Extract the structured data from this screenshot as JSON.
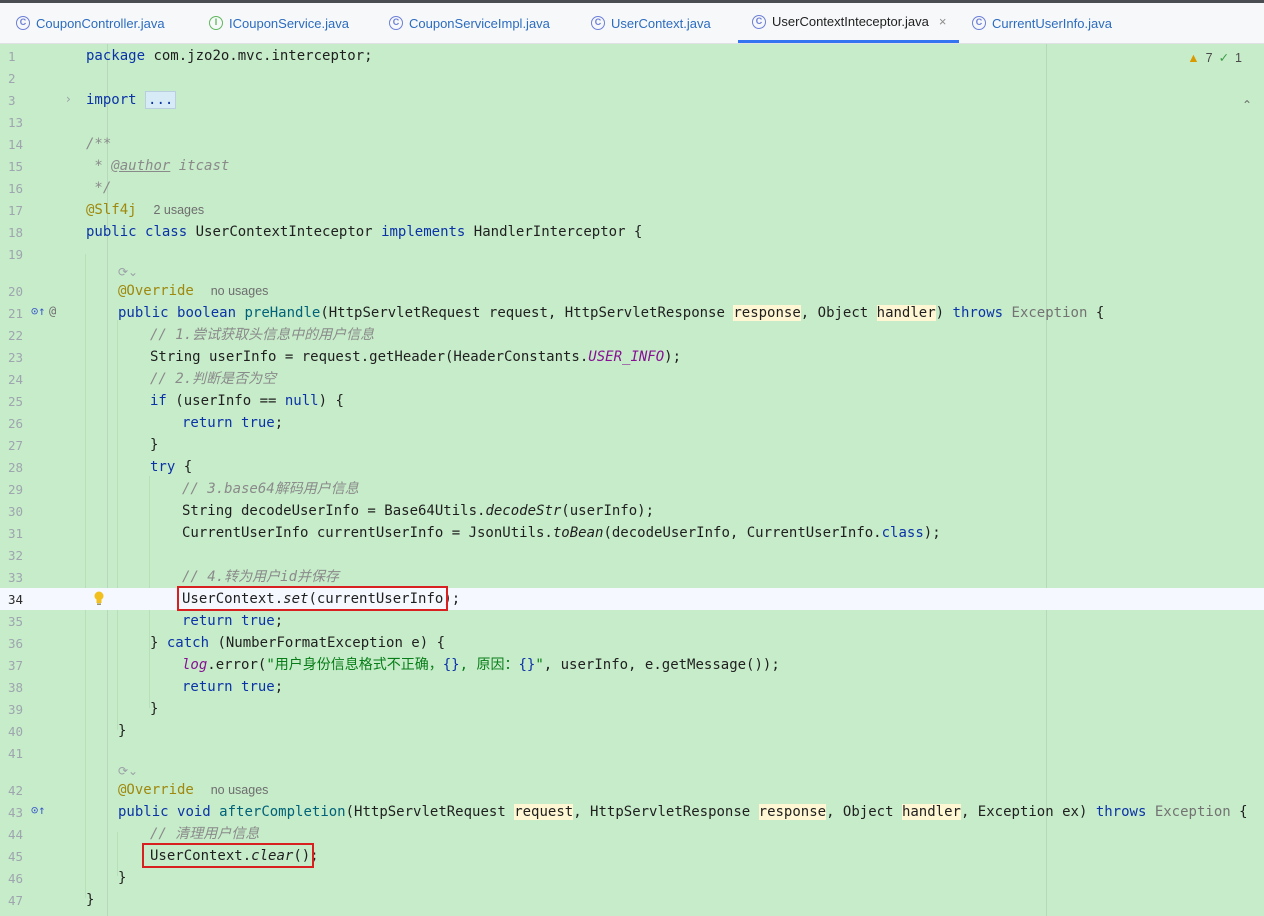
{
  "tabs": [
    {
      "label": "CouponController.java",
      "icon": "class-icon",
      "active": false
    },
    {
      "label": "ICouponService.java",
      "icon": "interface-icon",
      "active": false
    },
    {
      "label": "CouponServiceImpl.java",
      "icon": "class-icon",
      "active": false
    },
    {
      "label": "UserContext.java",
      "icon": "class-icon",
      "active": false
    },
    {
      "label": "UserContextInteceptor.java",
      "icon": "class-icon",
      "active": true
    },
    {
      "label": "CurrentUserInfo.java",
      "icon": "class-icon",
      "active": false
    }
  ],
  "inspections": {
    "warnings": "7",
    "weak_warnings": "1"
  },
  "current_line": "34",
  "code": {
    "l1_kw": "package",
    "l1_rest": " com.jzo2o.mvc.interceptor;",
    "l3_kw": "import",
    "l3_fold": "...",
    "l14": "/**",
    "l15_pre": " * ",
    "l15_tag": "@author",
    "l15_rest": " itcast",
    "l16": " */",
    "l17_ann": "@Slf4j",
    "l17_hint": "2 usages",
    "l18_kw1": "public",
    "l18_kw2": "class",
    "l18_name": "UserContextInteceptor",
    "l18_kw3": "implements",
    "l18_rest": " HandlerInterceptor {",
    "l20_ann": "@Override",
    "l20_hint": "no usages",
    "l21_kw1": "public",
    "l21_kw2": "boolean",
    "l21_method": "preHandle",
    "l21_a": "(HttpServletRequest request, HttpServletResponse ",
    "l21_p1": "response",
    "l21_b": ", Object ",
    "l21_p2": "handler",
    "l21_c": ") ",
    "l21_kw3": "throws",
    "l21_d": " Exception",
    "l21_e": " {",
    "l22": "// 1.尝试获取头信息中的用户信息",
    "l23_a": "String userInfo = request.getHeader(HeaderConstants.",
    "l23_const": "USER_INFO",
    "l23_b": ");",
    "l24": "// 2.判断是否为空",
    "l25_kw": "if",
    "l25_a": " (userInfo == ",
    "l25_kw2": "null",
    "l25_b": ") {",
    "l26_kw": "return",
    "l26_kw2": "true",
    "l26_b": ";",
    "l27": "}",
    "l28_kw": "try",
    "l28_b": " {",
    "l29": "// 3.base64解码用户信息",
    "l30_a": "String decodeUserInfo = Base64Utils.",
    "l30_m": "decodeStr",
    "l30_b": "(userInfo);",
    "l31_a": "CurrentUserInfo currentUserInfo = JsonUtils.",
    "l31_m": "toBean",
    "l31_b": "(decodeUserInfo, CurrentUserInfo.",
    "l31_kw": "class",
    "l31_c": ");",
    "l33": "// 4.转为用户id并保存",
    "l34_a": "UserContext.",
    "l34_m": "set",
    "l34_b": "(currentUserInfo);",
    "l35_kw": "return",
    "l35_kw2": "true",
    "l35_b": ";",
    "l36_a": "} ",
    "l36_kw": "catch",
    "l36_b": " (NumberFormatException e) {",
    "l37_field": "log",
    "l37_a": ".error(",
    "l37_str1": "\"用户身份信息格式不正确，",
    "l37_ph1": "{}",
    "l37_str2": ", 原因：",
    "l37_ph2": "{}",
    "l37_str3": "\"",
    "l37_b": ", userInfo, e.getMessage());",
    "l38_kw": "return",
    "l38_kw2": "true",
    "l38_b": ";",
    "l39": "}",
    "l40": "}",
    "l42_ann": "@Override",
    "l42_hint": "no usages",
    "l43_kw1": "public",
    "l43_kw2": "void",
    "l43_method": "afterCompletion",
    "l43_a": "(HttpServletRequest ",
    "l43_p1": "request",
    "l43_b": ", HttpServletResponse ",
    "l43_p2": "response",
    "l43_c": ", Object ",
    "l43_p3": "handler",
    "l43_d": ", Exception ex) ",
    "l43_kw3": "throws",
    "l43_e": " Exception",
    "l43_f": " {",
    "l44": "// 清理用户信息",
    "l45_a": "UserContext.",
    "l45_m": "clear",
    "l45_b": "();",
    "l46": "}",
    "l47": "}"
  },
  "line_numbers": [
    "1",
    "2",
    "3",
    "13",
    "14",
    "15",
    "16",
    "17",
    "18",
    "19",
    "20",
    "21",
    "22",
    "23",
    "24",
    "25",
    "26",
    "27",
    "28",
    "29",
    "30",
    "31",
    "32",
    "33",
    "34",
    "35",
    "36",
    "37",
    "38",
    "39",
    "40",
    "41",
    "42",
    "43",
    "44",
    "45",
    "46",
    "47"
  ]
}
